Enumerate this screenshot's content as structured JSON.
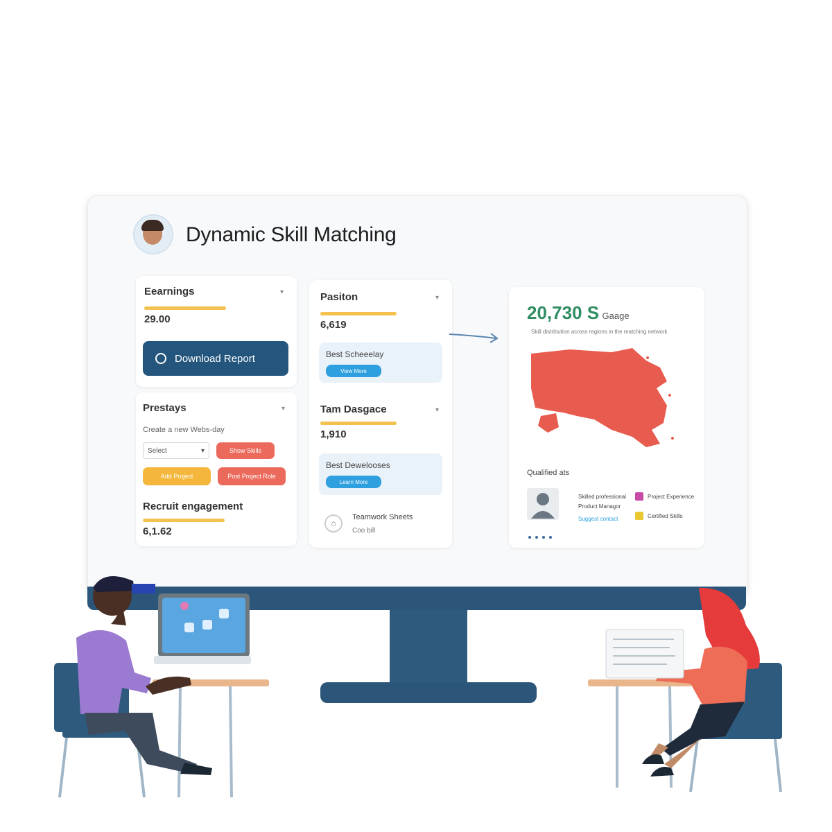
{
  "header": {
    "title": "Dynamic Skill Matching"
  },
  "cards": {
    "earnings": {
      "title": "Eearnings",
      "value": "29.00",
      "button_label": "Download Report"
    },
    "position": {
      "title": "Pasiton",
      "value": "6,619"
    },
    "priorities": {
      "title": "Prestays",
      "subtitle": "Create a new Webs-day",
      "select_value": "Select",
      "btn_1": "Show Skills",
      "btn_2": "Add Project",
      "btn_3": "Post Project Role"
    },
    "recruitment": {
      "title": "Recruit engagement",
      "value": "6,1.62"
    },
    "team_dashboard": {
      "title": "Tam Dasgace",
      "value": "1,910"
    },
    "subpanel_1": {
      "text": "Best Scheeelay",
      "button": "View More"
    },
    "subpanel_2": {
      "text": "Best Dewelooses",
      "button": "Learn More"
    },
    "footer_item": {
      "title": "Teamwork Sheets",
      "subtitle": "Coo bill"
    }
  },
  "right_panel": {
    "number": "20,730 S",
    "suffix": "Gaage",
    "caption": "Skill distribution across regions in the matching network",
    "section_title": "Qualified ats",
    "legend": [
      {
        "label": "Project Experience",
        "color": "#c64aa6"
      },
      {
        "label": "Certified Skills",
        "color": "#e8c832"
      }
    ],
    "profile_lines": [
      "Skilled professional",
      "Product Managor",
      "Suggest contact"
    ]
  },
  "colors": {
    "accent_blue": "#23557d",
    "accent_yellow": "#f2c14e",
    "map_red": "#e85c4f",
    "number_green": "#2f8d62"
  },
  "icons": [
    "avatar",
    "chevron-down-icon",
    "circle-icon",
    "arrow-right-icon",
    "map",
    "person-icon",
    "info-icon"
  ]
}
